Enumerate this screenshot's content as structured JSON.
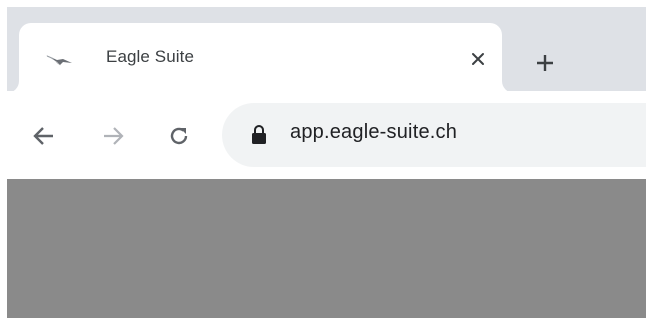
{
  "tab": {
    "title": "Eagle Suite",
    "favicon": "eagle-icon",
    "close_icon": "close-icon"
  },
  "tabstrip": {
    "new_tab_icon": "plus-icon"
  },
  "toolbar": {
    "back_icon": "arrow-left-icon",
    "forward_icon": "arrow-right-icon",
    "reload_icon": "reload-icon",
    "forward_enabled": false
  },
  "address_bar": {
    "url": "app.eagle-suite.ch",
    "lock_icon": "lock-icon"
  },
  "colors": {
    "tabstrip_bg": "#dee1e6",
    "omnibox_bg": "#f1f3f4",
    "content_bg": "#8a8a8a",
    "text": "#202124",
    "icon": "#5f6368",
    "icon_disabled": "#b0b3b8"
  }
}
